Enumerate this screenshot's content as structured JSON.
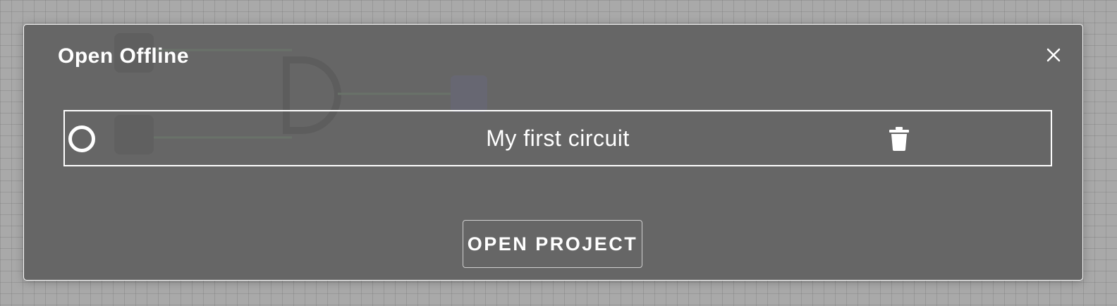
{
  "dialog": {
    "title": "Open Offline",
    "close_icon": "close-icon",
    "projects": [
      {
        "name": "My first circuit",
        "selected": false,
        "delete_icon": "trash-icon"
      }
    ],
    "open_button_label": "OPEN PROJECT"
  },
  "colors": {
    "overlay_background": "#a9a9a9",
    "dialog_background": "#666666",
    "border": "#ffffff",
    "text": "#ffffff"
  }
}
